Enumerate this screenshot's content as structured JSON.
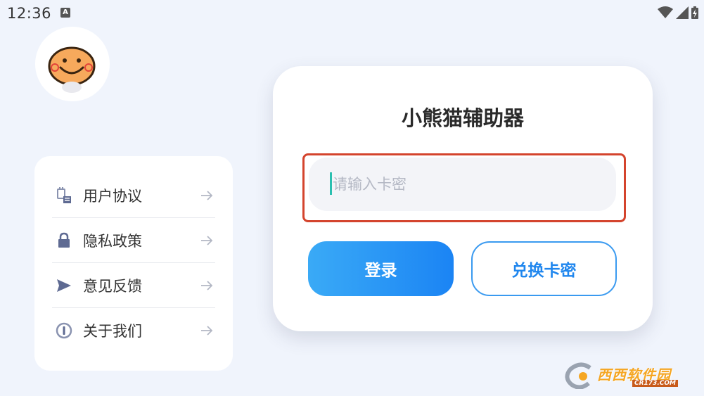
{
  "status_bar": {
    "time": "12:36",
    "notification_badge": "A"
  },
  "menu": {
    "items": [
      {
        "label": "用户协议",
        "icon": "agreement-icon"
      },
      {
        "label": "隐私政策",
        "icon": "lock-icon"
      },
      {
        "label": "意见反馈",
        "icon": "send-icon"
      },
      {
        "label": "关于我们",
        "icon": "info-icon"
      }
    ]
  },
  "login": {
    "title": "小熊猫辅助器",
    "input_placeholder": "请输入卡密",
    "input_value": "",
    "login_label": "登录",
    "redeem_label": "兑换卡密"
  },
  "watermark": {
    "text": "西西软件园",
    "sub": "CR173.COM"
  },
  "colors": {
    "accent": "#1b84f4",
    "highlight_border": "#d4442d",
    "background": "#f0f4fc"
  }
}
